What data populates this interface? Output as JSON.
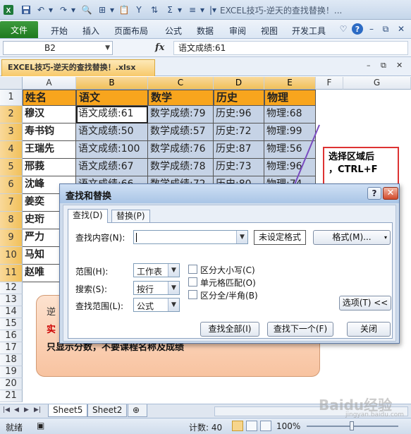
{
  "window": {
    "title": "EXCEL技巧-逆天的查找替换！...",
    "qat_icons": [
      "save-icon",
      "undo-icon",
      "redo-icon",
      "print-preview-icon",
      "borders-icon",
      "paste-icon",
      "filter-icon",
      "sort-icon",
      "sum-icon",
      "align-icon"
    ]
  },
  "ribbon": {
    "file_label": "文件",
    "tabs": [
      "开始",
      "插入",
      "页面布局",
      "公式",
      "数据",
      "审阅",
      "视图",
      "开发工具"
    ]
  },
  "formula_bar": {
    "name_box": "B2",
    "fx_label": "fx",
    "content": "语文成绩:61"
  },
  "workbook": {
    "tab_label": "EXCEL技巧-逆天的查找替换！.xlsx"
  },
  "grid": {
    "columns": [
      "A",
      "B",
      "C",
      "D",
      "E",
      "F",
      "G"
    ],
    "rows": [
      "1",
      "2",
      "3",
      "4",
      "5",
      "6",
      "7",
      "8",
      "9",
      "10",
      "11",
      "12",
      "13",
      "14",
      "15",
      "16",
      "17",
      "18",
      "19",
      "20",
      "21"
    ],
    "headers": [
      "姓名",
      "语文",
      "数学",
      "历史",
      "物理"
    ],
    "data": [
      [
        "穆汉",
        "语文成绩:61",
        "数学成绩:79",
        "历史:96",
        "物理:68"
      ],
      [
        "寿书钧",
        "语文成绩:50",
        "数学成绩:57",
        "历史:72",
        "物理:99"
      ],
      [
        "王瑞先",
        "语文成绩:100",
        "数学成绩:76",
        "历史:87",
        "物理:56"
      ],
      [
        "邢莪",
        "语文成绩:67",
        "数学成绩:78",
        "历史:73",
        "物理:96"
      ],
      [
        "沈峰",
        "语文成绩:66",
        "数学成绩:72",
        "历史:80",
        "物理:74"
      ],
      [
        "姜奕",
        "",
        "",
        "",
        ""
      ],
      [
        "史珩",
        "",
        "",
        "",
        ""
      ],
      [
        "严力",
        "",
        "",
        "",
        ""
      ],
      [
        "马知",
        "",
        "",
        "",
        ""
      ],
      [
        "赵唯",
        "",
        "",
        "",
        ""
      ]
    ]
  },
  "callout": {
    "line1": "逆",
    "line2": "实",
    "line3": "只显示分数，不要课程名称及成绩"
  },
  "annotation": {
    "line1": "选择区域后",
    "line2": "，CTRL+F"
  },
  "dialog": {
    "title": "查找和替换",
    "help": "?",
    "close": "✕",
    "tab_find": "查找(D)",
    "tab_replace": "替换(P)",
    "find_label": "查找内容(N):",
    "find_value": "",
    "format_status": "未设定格式",
    "format_button": "格式(M)...",
    "scope_label": "范围(H):",
    "scope_value": "工作表",
    "search_label": "搜索(S):",
    "search_value": "按行",
    "lookin_label": "查找范围(L):",
    "lookin_value": "公式",
    "match_case": "区分大小写(C)",
    "match_entire": "单元格匹配(O)",
    "match_width": "区分全/半角(B)",
    "options_button": "选项(T) <<",
    "find_all": "查找全部(I)",
    "find_next": "查找下一个(F)",
    "close_button": "关闭"
  },
  "sheet_tabs": [
    "Sheet5",
    "Sheet2"
  ],
  "status": {
    "ready": "就绪",
    "count": "计数: 40",
    "zoom": "100%"
  },
  "watermark": {
    "text": "Baidu经验",
    "sub": "jingyan.baidu.com"
  },
  "colors": {
    "header_fill": "#f8a51d",
    "selection_fill": "#c6d3e6",
    "file_tab": "#2a8a2a",
    "annotation_border": "#dd3333",
    "callout_fill": "#f8c3a0"
  }
}
